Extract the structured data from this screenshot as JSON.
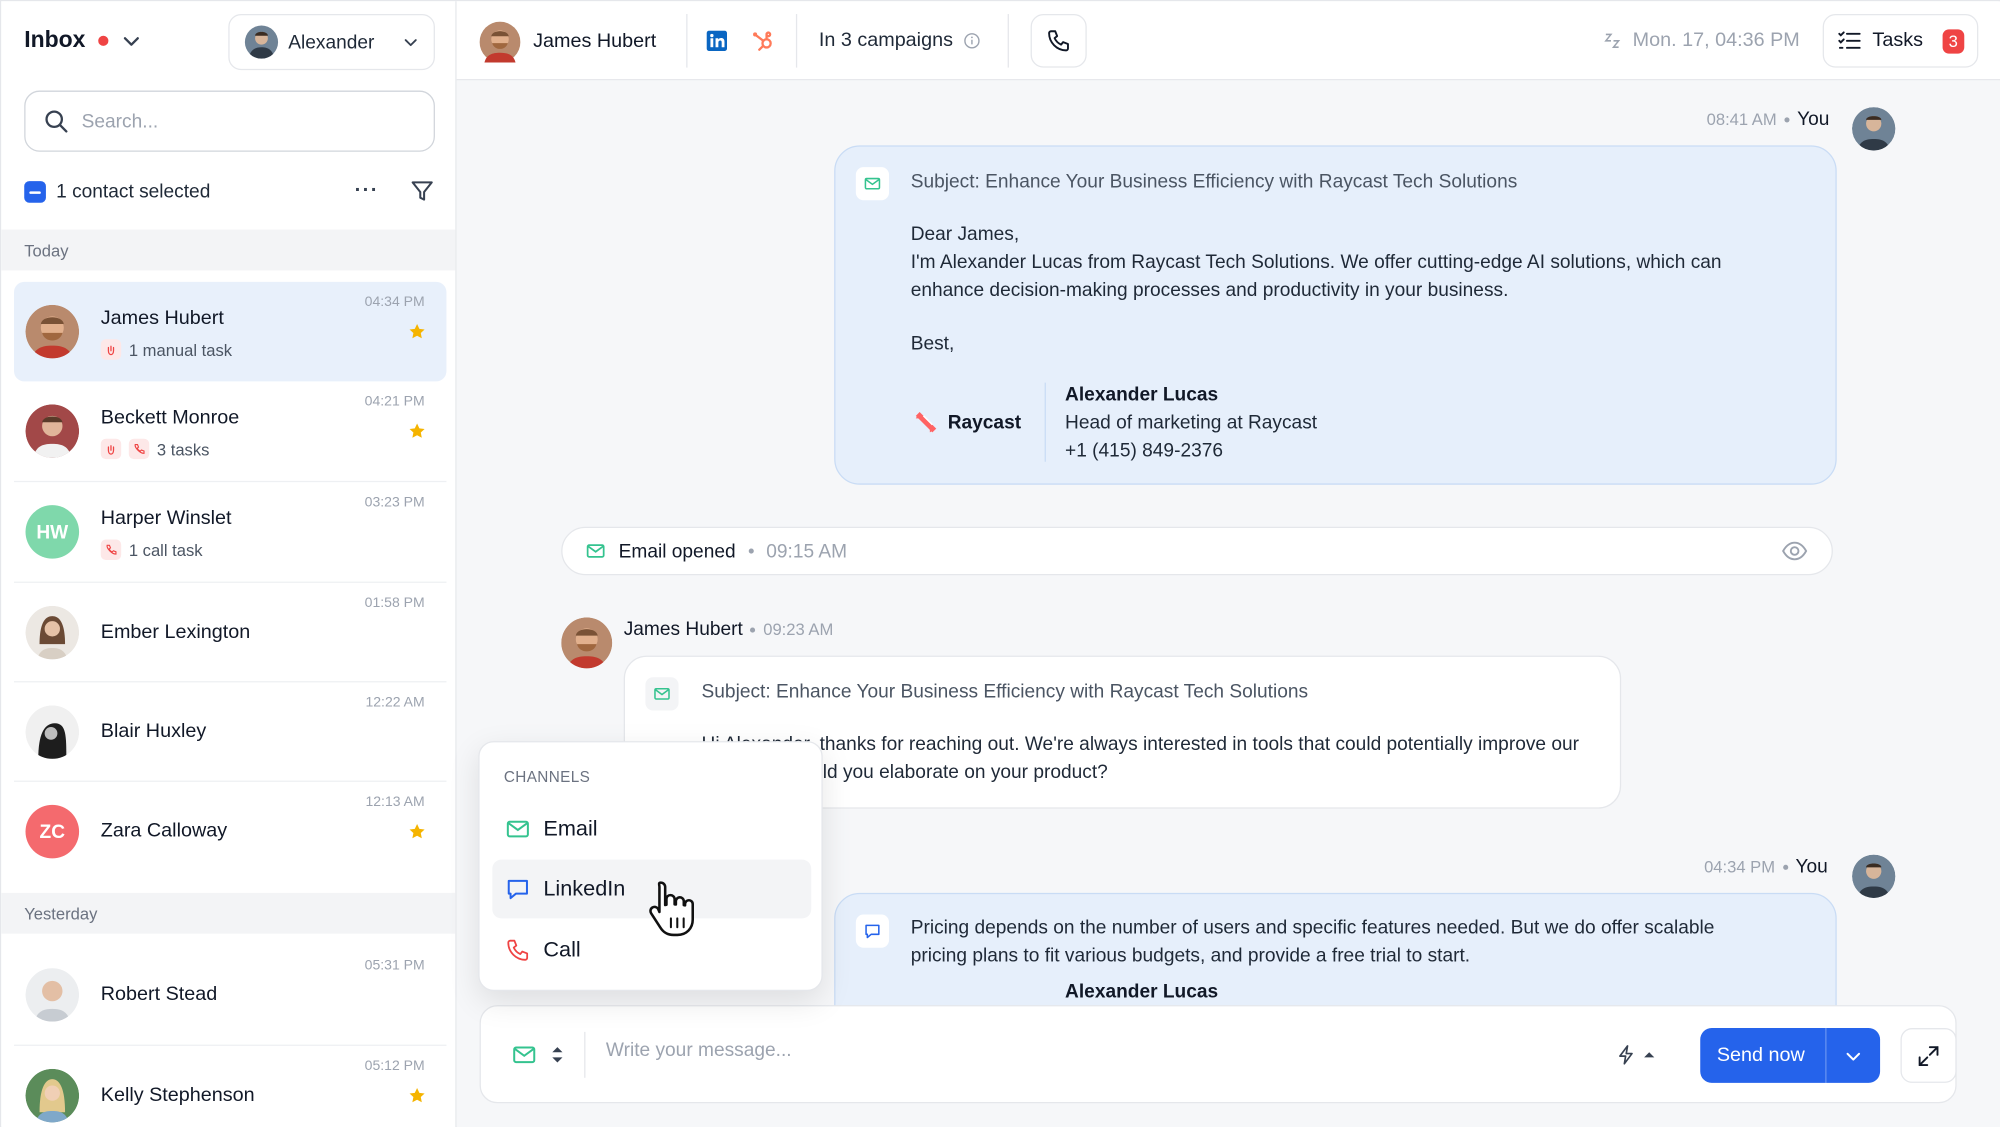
{
  "sidebar": {
    "inbox_title": "Inbox",
    "user_name": "Alexander",
    "search_placeholder": "Search...",
    "selected_text": "1 contact selected",
    "today_label": "Today",
    "yesterday_label": "Yesterday",
    "contacts": [
      {
        "name": "James Hubert",
        "time": "04:34 PM",
        "task": "1 manual task",
        "starred": true
      },
      {
        "name": "Beckett Monroe",
        "time": "04:21 PM",
        "task": "3 tasks",
        "starred": true
      },
      {
        "name": "Harper Winslet",
        "initials": "HW",
        "time": "03:23 PM",
        "task": "1 call task",
        "starred": false
      },
      {
        "name": "Ember Lexington",
        "time": "01:58 PM",
        "starred": false
      },
      {
        "name": "Blair Huxley",
        "time": "12:22 AM",
        "starred": false
      },
      {
        "name": "Zara Calloway",
        "initials": "ZC",
        "time": "12:13 AM",
        "starred": true
      },
      {
        "name": "Robert Stead",
        "time": "05:31 PM",
        "starred": false
      },
      {
        "name": "Kelly Stephenson",
        "time": "05:12 PM",
        "starred": true
      }
    ]
  },
  "topbar": {
    "contact_name": "James Hubert",
    "campaigns": "In 3 campaigns",
    "datetime": "Mon. 17, 04:36 PM",
    "tasks_label": "Tasks",
    "tasks_count": "3"
  },
  "chat": {
    "msg1": {
      "time": "08:41 AM",
      "sender": "You",
      "subject": "Subject: Enhance Your Business Efficiency with Raycast Tech Solutions",
      "greeting": "Dear James,",
      "line1": "I'm Alexander Lucas from Raycast Tech Solutions. We offer cutting-edge AI solutions, which can",
      "line2": "enhance decision-making processes and productivity in your business.",
      "closing": "Best,",
      "brand": "Raycast",
      "sig_name": "Alexander Lucas",
      "sig_title": "Head of marketing at Raycast",
      "sig_phone": "+1 (415) 849-2376"
    },
    "opened": {
      "label": "Email opened",
      "time": "09:15 AM"
    },
    "msg2": {
      "sender": "James Hubert",
      "time": "09:23 AM",
      "subject": "Subject: Enhance Your Business Efficiency with Raycast Tech Solutions",
      "line1": "Hi Alexander, thanks for reaching out. We're always interested in tools that could potentially improve our",
      "line2": "business. Could you elaborate on your product?"
    },
    "msg3": {
      "time": "04:34 PM",
      "sender": "You",
      "line1": "Pricing depends on the number of users and specific features needed. But we do offer scalable",
      "line2": "pricing plans to fit various budgets, and provide a free trial to start.",
      "sig_name": "Alexander Lucas"
    }
  },
  "composer": {
    "placeholder": "Write your message...",
    "send_label": "Send now"
  },
  "channels": {
    "header": "CHANNELS",
    "items": [
      "Email",
      "LinkedIn",
      "Call"
    ]
  },
  "colors": {
    "accent": "#2563eb",
    "danger": "#ef4444",
    "star": "#f5b400",
    "bubble_out": "#e6effb",
    "email_green": "#34c38f",
    "hubspot": "#ff7a59",
    "linkedin": "#0a66c2"
  }
}
